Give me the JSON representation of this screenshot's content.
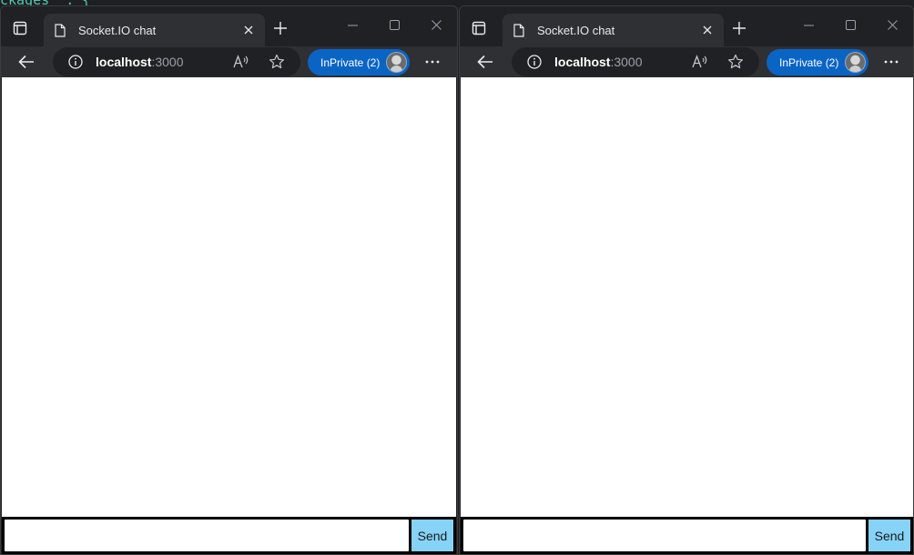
{
  "background": {
    "code_text": "ckages \": {"
  },
  "colors": {
    "inprivate_pill": "#0a64c4",
    "send_button": "#87d3f8",
    "titlebar": "#202124"
  },
  "windows": [
    {
      "tab": {
        "title": "Socket.IO chat"
      },
      "address": {
        "host": "localhost",
        "port": ":3000"
      },
      "inprivate": {
        "label": "InPrivate (2)"
      },
      "chat": {
        "input_value": "",
        "send_label": "Send",
        "messages": []
      }
    },
    {
      "tab": {
        "title": "Socket.IO chat"
      },
      "address": {
        "host": "localhost",
        "port": ":3000"
      },
      "inprivate": {
        "label": "InPrivate (2)"
      },
      "chat": {
        "input_value": "",
        "send_label": "Send",
        "messages": []
      }
    }
  ]
}
